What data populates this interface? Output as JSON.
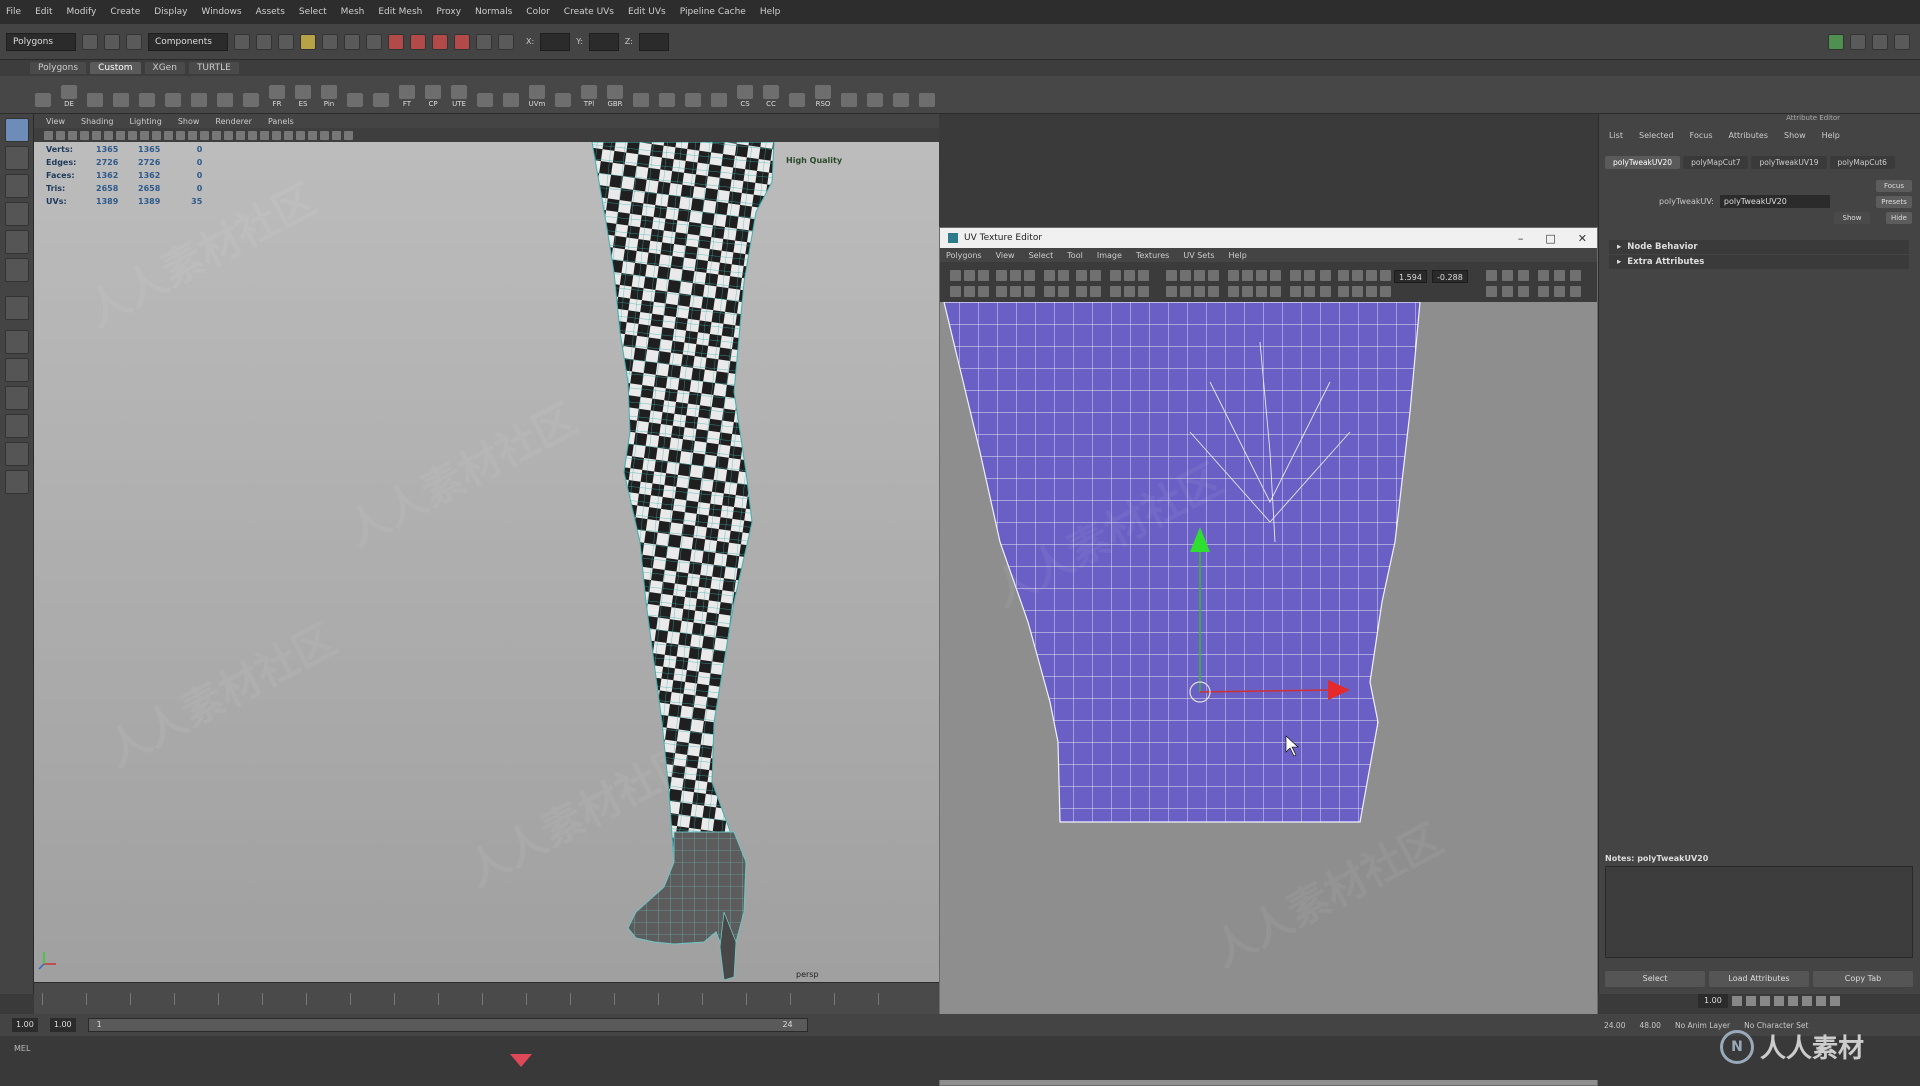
{
  "main_menu": [
    "File",
    "Edit",
    "Modify",
    "Create",
    "Display",
    "Windows",
    "Assets",
    "Select",
    "Mesh",
    "Edit Mesh",
    "Proxy",
    "Normals",
    "Color",
    "Create UVs",
    "Edit UVs",
    "Pipeline Cache",
    "Help"
  ],
  "status_line": {
    "mode": "Polygons",
    "components": "Components",
    "x_label": "X:",
    "y_label": "Y:",
    "z_label": "Z:"
  },
  "shelf_tabs": [
    "Polygons",
    "Custom",
    "XGen",
    "TURTLE"
  ],
  "shelf_active": "Custom",
  "shelf_icons": [
    "",
    "DE",
    "",
    "",
    "",
    "",
    "",
    "",
    "",
    "FR",
    "ES",
    "Pin",
    "",
    "",
    "FT",
    "CP",
    "UTE",
    "",
    "",
    "UVm",
    "",
    "TPl",
    "GBR",
    "",
    "",
    "",
    "",
    "CS",
    "CC",
    "",
    "RSO",
    "",
    "",
    "",
    ""
  ],
  "viewport": {
    "menu": [
      "View",
      "Shading",
      "Lighting",
      "Show",
      "Renderer",
      "Panels"
    ],
    "hud": [
      {
        "label": "Verts:",
        "v1": "1365",
        "v2": "1365",
        "v3": "0"
      },
      {
        "label": "Edges:",
        "v1": "2726",
        "v2": "2726",
        "v3": "0"
      },
      {
        "label": "Faces:",
        "v1": "1362",
        "v2": "1362",
        "v3": "0"
      },
      {
        "label": "Tris:",
        "v1": "2658",
        "v2": "2658",
        "v3": "0"
      },
      {
        "label": "UVs:",
        "v1": "1389",
        "v2": "1389",
        "v3": "35"
      }
    ],
    "quality_label": "High Quality",
    "camera_label": "persp"
  },
  "uv_editor": {
    "title": "UV Texture Editor",
    "menu": [
      "Polygons",
      "View",
      "Select",
      "Tool",
      "Image",
      "Textures",
      "UV Sets",
      "Help"
    ],
    "field_u": "1.594",
    "field_v": "-0.288",
    "mesh_color": "#6a5fc4"
  },
  "attribute_editor": {
    "title": "Attribute Editor",
    "menu": [
      "List",
      "Selected",
      "Focus",
      "Attributes",
      "Show",
      "Help"
    ],
    "tabs": [
      "polyTweakUV20",
      "polyMapCut7",
      "polyTweakUV19",
      "polyMapCut6"
    ],
    "active_tab": "polyTweakUV20",
    "node_label": "polyTweakUV:",
    "node_value": "polyTweakUV20",
    "focus_btn": "Focus",
    "presets_btn": "Presets",
    "show_btn": "Show",
    "hide_btn": "Hide",
    "sections": [
      "Node Behavior",
      "Extra Attributes"
    ],
    "notes_label": "Notes: polyTweakUV20",
    "bottom_buttons": [
      "Select",
      "Load Attributes",
      "Copy Tab"
    ]
  },
  "timeline": {
    "start": "1.00",
    "end_display": "1.00",
    "frame": "1",
    "end_frame": "24",
    "current_time": "1.00"
  },
  "range_right": {
    "range_start": "24.00",
    "range_end": "48.00",
    "anim_layer": "No Anim Layer",
    "char_set": "No Character Set"
  },
  "command_line": {
    "lang": "MEL"
  },
  "watermark": "人人素材社区",
  "logo_text": "人人素材"
}
